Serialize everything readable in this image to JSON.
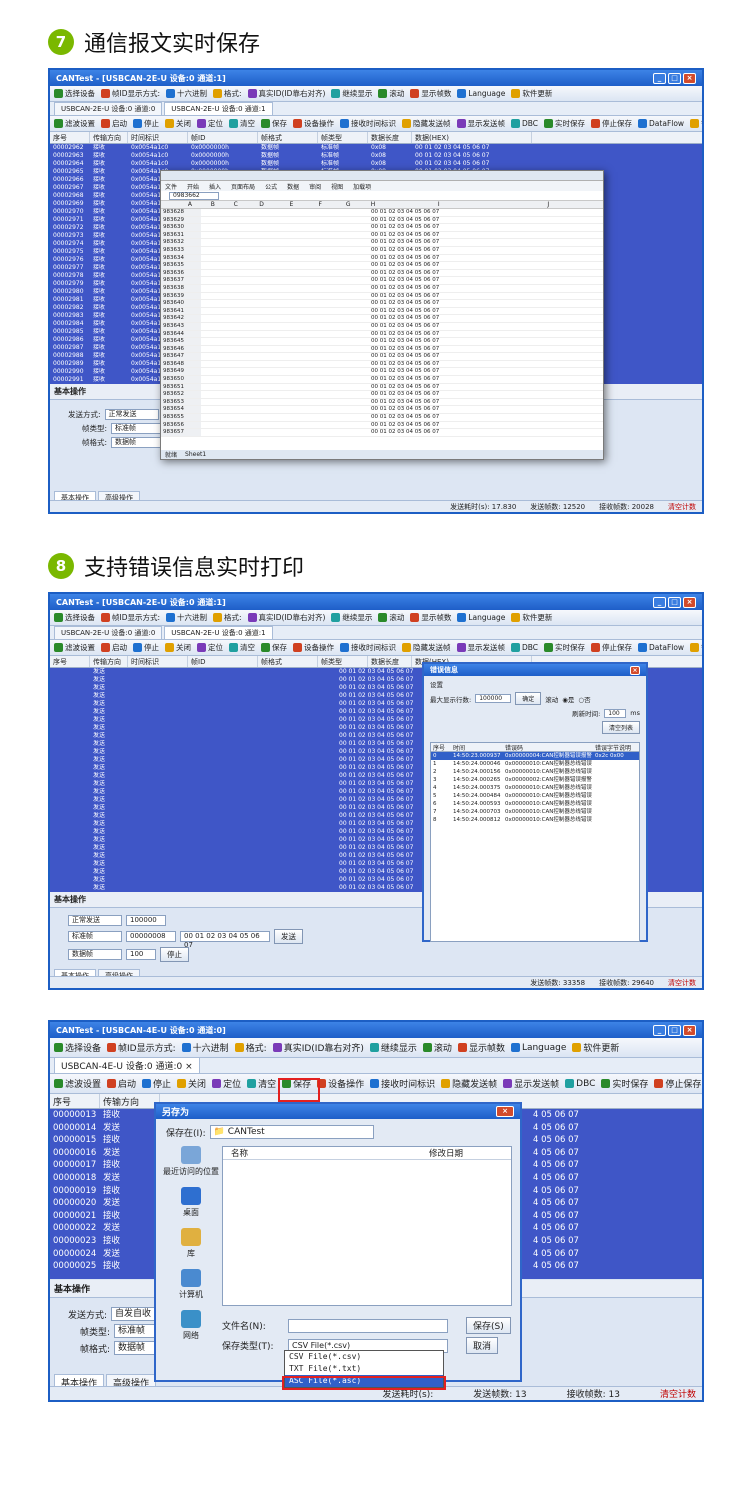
{
  "sections": [
    {
      "number": "7",
      "title": "通信报文实时保存"
    },
    {
      "number": "8",
      "title": "支持错误信息实时打印"
    }
  ],
  "colors": {
    "accent_badge": "#7ab800",
    "grid_blue": "#3f56c7",
    "title_blue": "#1e5ec8",
    "highlight_red": "#e32020"
  },
  "win1": {
    "title": "CANTest - [USBCAN-2E-U 设备:0 通道:1]",
    "toolbar": [
      "选择设备",
      "帧ID显示方式:",
      "十六进制",
      "格式:",
      "真实ID(ID靠右对齐)",
      "继续显示",
      "滚动",
      "显示帧数",
      "Language",
      "软件更新"
    ],
    "tabs": [
      "USBCAN-2E-U 设备:0 通道:0",
      "USBCAN-2E-U 设备:0 通道:1"
    ],
    "actions": [
      "滤波设置",
      "启动",
      "停止",
      "关闭",
      "定位",
      "清空",
      "保存",
      "设备操作",
      "接收时间标识",
      "隐藏发送帧",
      "显示发送帧",
      "DBC",
      "实时保存",
      "停止保存",
      "DataFlow",
      "错误信息"
    ],
    "columns": [
      "序号",
      "传输方向",
      "时间标识",
      "帧ID",
      "帧格式",
      "帧类型",
      "数据长度",
      "数据(HEX)"
    ],
    "row_ids": [
      "00002962",
      "00002963",
      "00002964",
      "00002965",
      "00002966",
      "00002967",
      "00002968",
      "00002969",
      "00002970",
      "00002971",
      "00002972",
      "00002973",
      "00002974",
      "00002975",
      "00002976",
      "00002977",
      "00002978",
      "00002979",
      "00002980",
      "00002981",
      "00002982",
      "00002983",
      "00002984",
      "00002985",
      "00002986",
      "00002987",
      "00002988",
      "00002989",
      "00002990",
      "00002991"
    ],
    "row_dir": "接收",
    "row_time": "0x0054a1c0",
    "row_id": "0x0000000h",
    "row_fmt": "数据帧",
    "row_type": "标准帧",
    "row_len": "0x08",
    "row_data": "00 01 02 03 04 05 06 07",
    "panel_title": "基本操作",
    "send_mode_label": "发送方式:",
    "send_mode": "正常发送",
    "frame_type_label": "帧类型:",
    "frame_type": "标准帧",
    "frame_fmt_label": "帧格式:",
    "frame_fmt": "数据帧",
    "bottom_tabs": [
      "基本操作",
      "高级操作"
    ],
    "status": [
      "发送耗时(s): 17.830",
      "发送帧数: 12520",
      "接收帧数: 20028",
      "清空计数"
    ],
    "excel": {
      "cell_ref": "0983662",
      "ribbon": [
        "文件",
        "开始",
        "插入",
        "页面布局",
        "公式",
        "数据",
        "审阅",
        "视图",
        "加载项"
      ],
      "cols": [
        "A",
        "B",
        "C",
        "D",
        "E",
        "F",
        "G",
        "H",
        "I",
        "J"
      ],
      "row_nums": [
        "983628",
        "983629",
        "983630",
        "983631",
        "983632",
        "983633",
        "983634",
        "983635",
        "983636",
        "983637",
        "983638",
        "983639",
        "983640",
        "983641",
        "983642",
        "983643",
        "983644",
        "983645",
        "983646",
        "983647",
        "983648",
        "983649",
        "983650",
        "983651",
        "983652",
        "983653",
        "983654",
        "983655",
        "983656",
        "983657"
      ],
      "sheet_tab": "Sheet1",
      "status": "就绪"
    }
  },
  "win2": {
    "title": "CANTest - [USBCAN-2E-U 设备:0 通道:1]",
    "toolbar": [
      "选择设备",
      "帧ID显示方式:",
      "十六进制",
      "格式:",
      "真实ID(ID靠右对齐)",
      "继续显示",
      "滚动",
      "显示帧数",
      "Language",
      "软件更新"
    ],
    "tabs": [
      "USBCAN-2E-U 设备:0 通道:0",
      "USBCAN-2E-U 设备:0 通道:1"
    ],
    "columns": [
      "序号",
      "传输方向",
      "时间标识",
      "帧ID",
      "帧格式",
      "帧类型",
      "数据长度",
      "数据(HEX)"
    ],
    "row_dir": "发送",
    "row_data": "00 01 02 03 04 05 06 07",
    "panel_title": "基本操作",
    "send_mode": "正常发送",
    "frame_type": "标准帧",
    "frame_fmt": "数据帧",
    "frame_id": "00000008",
    "data_hex": "00 01 02 03 04 05 06 07",
    "send_count": "100000",
    "interval": "100",
    "btn_send": "发送",
    "btn_stop": "停止",
    "bottom_tabs": [
      "基本操作",
      "高级操作"
    ],
    "status": [
      "发送帧数: 33358",
      "接收帧数: 29640",
      "清空计数"
    ],
    "err_dialog": {
      "title": "错误信息",
      "settings": "设置",
      "rows_label": "最大显示行数:",
      "rows_value": "100000",
      "ok": "确定",
      "scroll": "滚动",
      "yes": "是",
      "no": "否",
      "refresh_label": "刷新时间:",
      "refresh_value": "100",
      "ms": "ms",
      "clear": "清空列表",
      "columns": [
        "序号",
        "时间",
        "错误码",
        "错误字节说明"
      ],
      "rows": [
        [
          "0",
          "14:50:23.000937",
          "0x00000004:CAN控制器错误报警",
          "0x2c 0x00"
        ],
        [
          "1",
          "14:50:24.000046",
          "0x00000010:CAN控制器总线错误",
          ""
        ],
        [
          "2",
          "14:50:24.000156",
          "0x00000010:CAN控制器总线错误",
          ""
        ],
        [
          "3",
          "14:50:24.000265",
          "0x00000002:CAN控制器错误报警",
          ""
        ],
        [
          "4",
          "14:50:24.000375",
          "0x00000010:CAN控制器总线错误",
          ""
        ],
        [
          "5",
          "14:50:24.000484",
          "0x00000010:CAN控制器总线错误",
          ""
        ],
        [
          "6",
          "14:50:24.000593",
          "0x00000010:CAN控制器总线错误",
          ""
        ],
        [
          "7",
          "14:50:24.000703",
          "0x00000010:CAN控制器总线错误",
          ""
        ],
        [
          "8",
          "14:50:24.000812",
          "0x00000010:CAN控制器总线错误",
          ""
        ]
      ]
    }
  },
  "win3": {
    "title": "CANTest - [USBCAN-4E-U 设备:0 通道:0]",
    "toolbar": [
      "选择设备",
      "帧ID显示方式:",
      "十六进制",
      "格式:",
      "真实ID(ID靠右对齐)",
      "继续显示",
      "滚动",
      "显示帧数",
      "Language",
      "软件更新"
    ],
    "tab": "USBCAN-4E-U 设备:0 通道:0",
    "actions": [
      "滤波设置",
      "启动",
      "停止",
      "关闭",
      "定位",
      "清空",
      "保存",
      "设备操作",
      "接收时间标识",
      "隐藏发送帧",
      "显示发送帧",
      "DBC",
      "实时保存",
      "停止保存"
    ],
    "columns": [
      "序号",
      "传输方向"
    ],
    "rows": [
      [
        "00000013",
        "接收"
      ],
      [
        "00000014",
        "发送"
      ],
      [
        "00000015",
        "接收"
      ],
      [
        "00000016",
        "发送"
      ],
      [
        "00000017",
        "接收"
      ],
      [
        "00000018",
        "发送"
      ],
      [
        "00000019",
        "接收"
      ],
      [
        "00000020",
        "发送"
      ],
      [
        "00000021",
        "接收"
      ],
      [
        "00000022",
        "发送"
      ],
      [
        "00000023",
        "接收"
      ],
      [
        "00000024",
        "发送"
      ],
      [
        "00000025",
        "接收"
      ]
    ],
    "row_data_tail": "4 05 06 07",
    "panel_title": "基本操作",
    "send_mode_label": "发送方式:",
    "send_mode": "自发自收",
    "frame_type_label": "帧类型:",
    "frame_type": "标准帧",
    "frame_fmt_label": "帧格式:",
    "frame_fmt": "数据帧",
    "bottom_tabs": [
      "基本操作",
      "高级操作"
    ],
    "status": [
      "发送耗时(s):",
      "发送帧数: 13",
      "接收帧数: 13",
      "清空计数"
    ],
    "save_dialog": {
      "title": "另存为",
      "save_in_label": "保存在(I):",
      "save_in_value": "CANTest",
      "col_name": "名称",
      "col_date": "修改日期",
      "places": [
        "最近访问的位置",
        "桌面",
        "库",
        "计算机",
        "网络"
      ],
      "file_name_label": "文件名(N):",
      "file_type_label": "保存类型(T):",
      "file_type_value": "CSV File(*.csv)",
      "options": [
        "CSV File(*.csv)",
        "TXT File(*.txt)",
        "ASC File(*.asc)"
      ],
      "save_btn": "保存(S)",
      "cancel_btn": "取消"
    }
  }
}
